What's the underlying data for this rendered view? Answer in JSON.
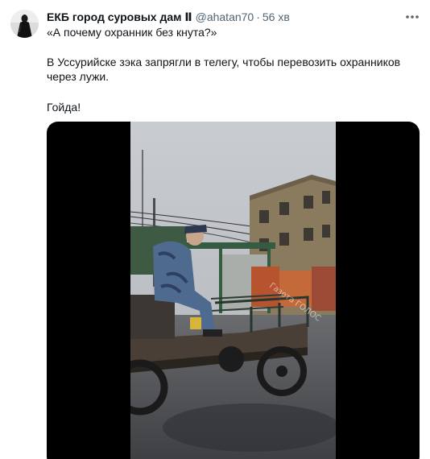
{
  "tweet": {
    "author": {
      "display_name": "ЕКБ город суровых дам Ⅱ",
      "handle": "@ahatan70",
      "separator": "·",
      "time": "56 хв"
    },
    "text": {
      "line1": "«А почему охранник без кнута?»",
      "line2": "В Уссурийске зэка запрягли в телегу, чтобы перевозить охранников",
      "line3": "через лужи.",
      "line4": "Гойда!"
    },
    "media": {
      "watermark": "Газета ГОЛОС"
    }
  },
  "icons": {
    "more": "more-horizontal-icon",
    "avatar": "avatar"
  },
  "colors": {
    "text": "#0f1419",
    "secondary": "#536471",
    "media_bg": "#000000"
  }
}
